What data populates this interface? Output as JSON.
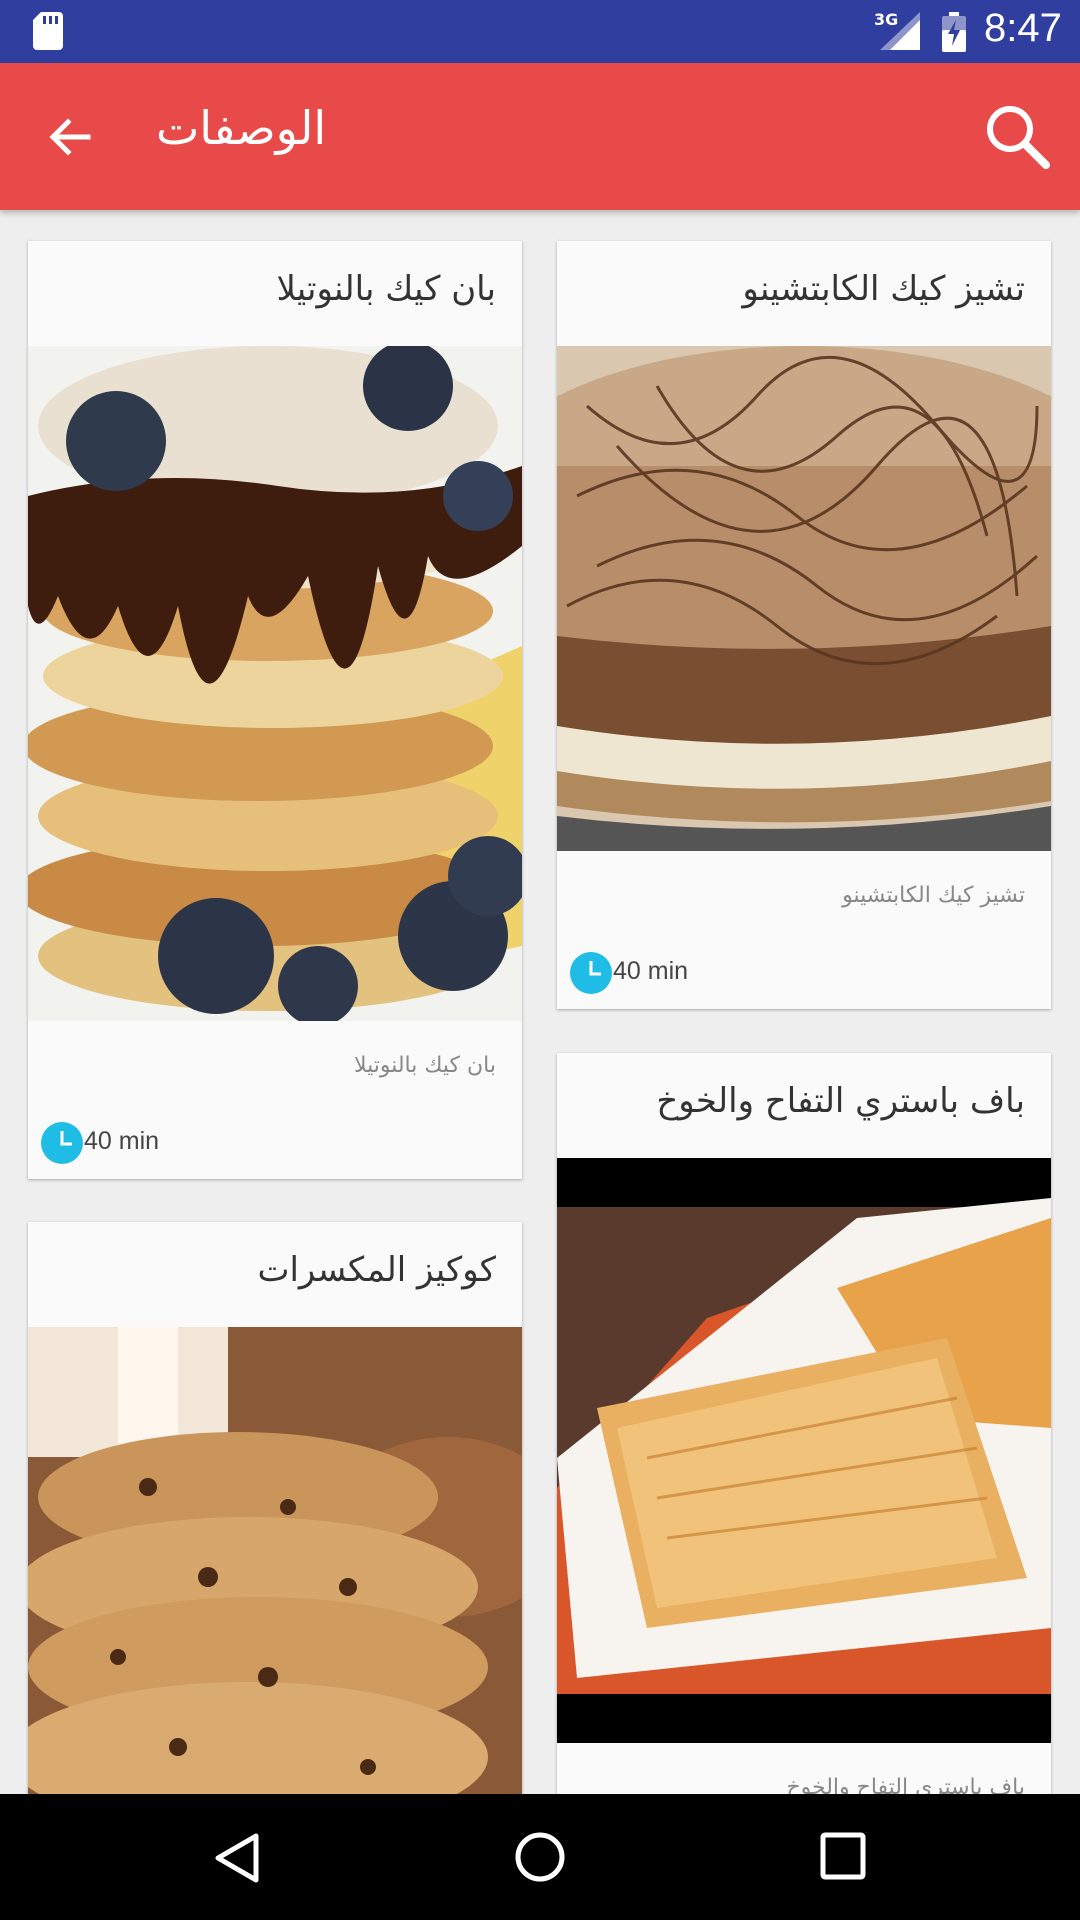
{
  "status_bar": {
    "network": "3G",
    "time": "8:47"
  },
  "app_bar": {
    "title": "الوصفات"
  },
  "colors": {
    "status_bar": "#303f9f",
    "app_bar": "#e84a4a",
    "clock_accent": "#1fbde6"
  },
  "recipes": [
    {
      "title": "تشيز كيك الكابتشينو",
      "description": "تشيز كيك الكابتشينو",
      "time": "40 min"
    },
    {
      "title": "بان كيك بالنوتيلا",
      "description": "بان كيك بالنوتيلا",
      "time": "40 min"
    },
    {
      "title": "باف باستري التفاح والخوخ",
      "description": "باف باستري التفاح والخوخ"
    },
    {
      "title": "كوكيز المكسرات"
    }
  ]
}
